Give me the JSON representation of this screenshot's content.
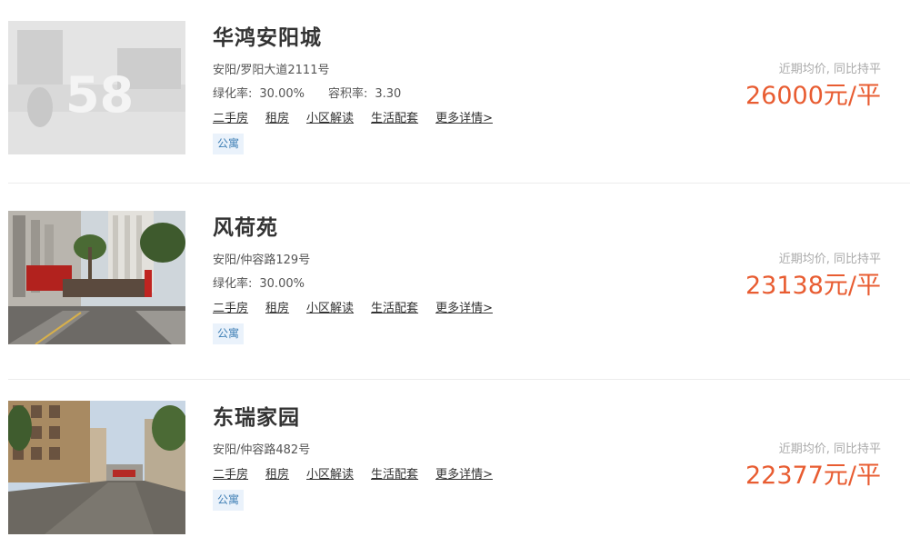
{
  "listings": [
    {
      "name": "华鸿安阳城",
      "address": "安阳/罗阳大道2111号",
      "greening_label": "绿化率:",
      "greening_value": "30.00%",
      "plot_ratio_label": "容积率:",
      "plot_ratio_value": "3.30",
      "links": [
        "二手房",
        "租房",
        "小区解读",
        "生活配套",
        "更多详情>"
      ],
      "tag": "公寓",
      "price_note": "近期均价, 同比持平",
      "price": "26000元/平",
      "image": "placeholder-58-logo",
      "placeholder_logo_text": "58"
    },
    {
      "name": "风荷苑",
      "address": "安阳/仲容路129号",
      "greening_label": "绿化率:",
      "greening_value": "30.00%",
      "links": [
        "二手房",
        "租房",
        "小区解读",
        "生活配套",
        "更多详情>"
      ],
      "tag": "公寓",
      "price_note": "近期均价, 同比持平",
      "price": "23138元/平",
      "image": "community-gate-photo"
    },
    {
      "name": "东瑞家园",
      "address": "安阳/仲容路482号",
      "links": [
        "二手房",
        "租房",
        "小区解读",
        "生活配套",
        "更多详情>"
      ],
      "tag": "公寓",
      "price_note": "近期均价, 同比持平",
      "price": "22377元/平",
      "image": "community-street-photo"
    }
  ],
  "colors": {
    "price": "#e85c31",
    "tag_text": "#3f7fb5",
    "tag_bg": "#eaf2fb",
    "muted": "#aaaaaa"
  }
}
